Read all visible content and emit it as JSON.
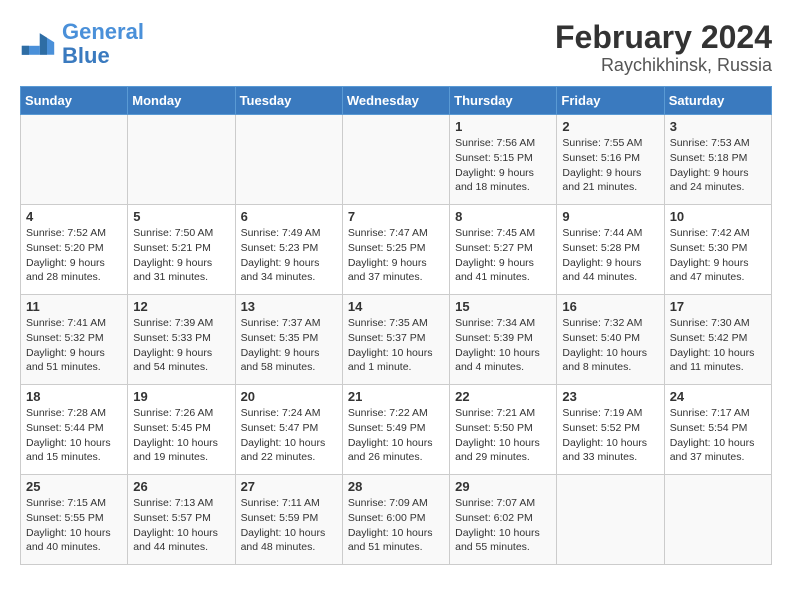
{
  "header": {
    "logo_line1": "General",
    "logo_line2": "Blue",
    "title": "February 2024",
    "subtitle": "Raychikhinsk, Russia"
  },
  "weekdays": [
    "Sunday",
    "Monday",
    "Tuesday",
    "Wednesday",
    "Thursday",
    "Friday",
    "Saturday"
  ],
  "weeks": [
    [
      {
        "day": "",
        "content": ""
      },
      {
        "day": "",
        "content": ""
      },
      {
        "day": "",
        "content": ""
      },
      {
        "day": "",
        "content": ""
      },
      {
        "day": "1",
        "content": "Sunrise: 7:56 AM\nSunset: 5:15 PM\nDaylight: 9 hours\nand 18 minutes."
      },
      {
        "day": "2",
        "content": "Sunrise: 7:55 AM\nSunset: 5:16 PM\nDaylight: 9 hours\nand 21 minutes."
      },
      {
        "day": "3",
        "content": "Sunrise: 7:53 AM\nSunset: 5:18 PM\nDaylight: 9 hours\nand 24 minutes."
      }
    ],
    [
      {
        "day": "4",
        "content": "Sunrise: 7:52 AM\nSunset: 5:20 PM\nDaylight: 9 hours\nand 28 minutes."
      },
      {
        "day": "5",
        "content": "Sunrise: 7:50 AM\nSunset: 5:21 PM\nDaylight: 9 hours\nand 31 minutes."
      },
      {
        "day": "6",
        "content": "Sunrise: 7:49 AM\nSunset: 5:23 PM\nDaylight: 9 hours\nand 34 minutes."
      },
      {
        "day": "7",
        "content": "Sunrise: 7:47 AM\nSunset: 5:25 PM\nDaylight: 9 hours\nand 37 minutes."
      },
      {
        "day": "8",
        "content": "Sunrise: 7:45 AM\nSunset: 5:27 PM\nDaylight: 9 hours\nand 41 minutes."
      },
      {
        "day": "9",
        "content": "Sunrise: 7:44 AM\nSunset: 5:28 PM\nDaylight: 9 hours\nand 44 minutes."
      },
      {
        "day": "10",
        "content": "Sunrise: 7:42 AM\nSunset: 5:30 PM\nDaylight: 9 hours\nand 47 minutes."
      }
    ],
    [
      {
        "day": "11",
        "content": "Sunrise: 7:41 AM\nSunset: 5:32 PM\nDaylight: 9 hours\nand 51 minutes."
      },
      {
        "day": "12",
        "content": "Sunrise: 7:39 AM\nSunset: 5:33 PM\nDaylight: 9 hours\nand 54 minutes."
      },
      {
        "day": "13",
        "content": "Sunrise: 7:37 AM\nSunset: 5:35 PM\nDaylight: 9 hours\nand 58 minutes."
      },
      {
        "day": "14",
        "content": "Sunrise: 7:35 AM\nSunset: 5:37 PM\nDaylight: 10 hours\nand 1 minute."
      },
      {
        "day": "15",
        "content": "Sunrise: 7:34 AM\nSunset: 5:39 PM\nDaylight: 10 hours\nand 4 minutes."
      },
      {
        "day": "16",
        "content": "Sunrise: 7:32 AM\nSunset: 5:40 PM\nDaylight: 10 hours\nand 8 minutes."
      },
      {
        "day": "17",
        "content": "Sunrise: 7:30 AM\nSunset: 5:42 PM\nDaylight: 10 hours\nand 11 minutes."
      }
    ],
    [
      {
        "day": "18",
        "content": "Sunrise: 7:28 AM\nSunset: 5:44 PM\nDaylight: 10 hours\nand 15 minutes."
      },
      {
        "day": "19",
        "content": "Sunrise: 7:26 AM\nSunset: 5:45 PM\nDaylight: 10 hours\nand 19 minutes."
      },
      {
        "day": "20",
        "content": "Sunrise: 7:24 AM\nSunset: 5:47 PM\nDaylight: 10 hours\nand 22 minutes."
      },
      {
        "day": "21",
        "content": "Sunrise: 7:22 AM\nSunset: 5:49 PM\nDaylight: 10 hours\nand 26 minutes."
      },
      {
        "day": "22",
        "content": "Sunrise: 7:21 AM\nSunset: 5:50 PM\nDaylight: 10 hours\nand 29 minutes."
      },
      {
        "day": "23",
        "content": "Sunrise: 7:19 AM\nSunset: 5:52 PM\nDaylight: 10 hours\nand 33 minutes."
      },
      {
        "day": "24",
        "content": "Sunrise: 7:17 AM\nSunset: 5:54 PM\nDaylight: 10 hours\nand 37 minutes."
      }
    ],
    [
      {
        "day": "25",
        "content": "Sunrise: 7:15 AM\nSunset: 5:55 PM\nDaylight: 10 hours\nand 40 minutes."
      },
      {
        "day": "26",
        "content": "Sunrise: 7:13 AM\nSunset: 5:57 PM\nDaylight: 10 hours\nand 44 minutes."
      },
      {
        "day": "27",
        "content": "Sunrise: 7:11 AM\nSunset: 5:59 PM\nDaylight: 10 hours\nand 48 minutes."
      },
      {
        "day": "28",
        "content": "Sunrise: 7:09 AM\nSunset: 6:00 PM\nDaylight: 10 hours\nand 51 minutes."
      },
      {
        "day": "29",
        "content": "Sunrise: 7:07 AM\nSunset: 6:02 PM\nDaylight: 10 hours\nand 55 minutes."
      },
      {
        "day": "",
        "content": ""
      },
      {
        "day": "",
        "content": ""
      }
    ]
  ]
}
